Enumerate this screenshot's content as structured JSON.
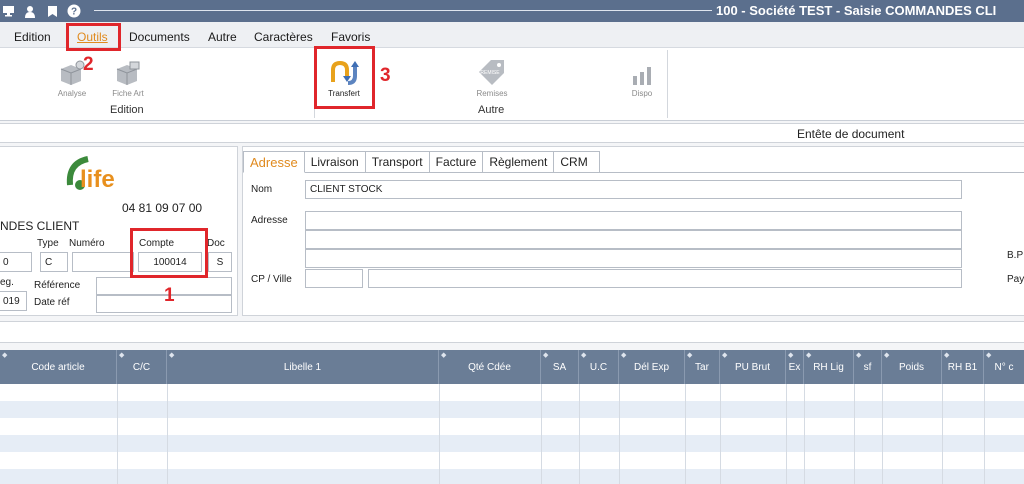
{
  "window": {
    "title": "100 - Société TEST - Saisie COMMANDES CLI"
  },
  "menu": {
    "items": [
      "Edition",
      "Outils",
      "Documents",
      "Autre",
      "Caractères",
      "Favoris"
    ]
  },
  "ribbon": {
    "buttons": {
      "analyse": "Analyse",
      "fiche_art": "Fiche Art",
      "transfert": "Transfert",
      "remises": "Remises",
      "dispo": "Dispo"
    },
    "groups": {
      "edition": "Edition",
      "autre": "Autre"
    }
  },
  "annotations": [
    "1",
    "2",
    "3"
  ],
  "header_strip": {
    "title": "Entête de document"
  },
  "left_panel": {
    "logo_text": "life",
    "phone": "04 81 09 07 00",
    "doc_title": "NDES CLIENT",
    "labels": {
      "type": "Type",
      "numero": "Numéro",
      "compte": "Compte",
      "doc": "Doc",
      "reg": "eg.",
      "reference": "Référence",
      "date_ref": "Date réf"
    },
    "fields": {
      "first": "0",
      "type": "C",
      "numero": "",
      "compte": "100014",
      "doc": "S",
      "date_partial": "019",
      "reference": "",
      "date_ref": ""
    }
  },
  "tabs": [
    "Adresse",
    "Livraison",
    "Transport",
    "Facture",
    "Règlement",
    "CRM"
  ],
  "address": {
    "labels": {
      "nom": "Nom",
      "adresse": "Adresse",
      "cp_ville": "CP / Ville",
      "bp": "B.P",
      "pays": "Pay"
    },
    "nom_value": "CLIENT STOCK",
    "adresse_lines": [
      "",
      "",
      ""
    ],
    "cp": "",
    "ville": ""
  },
  "grid": {
    "columns": [
      "Code article",
      "C/C",
      "Libelle 1",
      "Qté Cdée",
      "SA",
      "U.C",
      "Dél Exp",
      "Tar",
      "PU Brut",
      "Ex",
      "RH Lig",
      "sf",
      "Poids",
      "RH B1",
      "N° c"
    ]
  },
  "colors": {
    "title_bar": "#5b6f8d",
    "accent": "#e08a1e",
    "annotation": "#e0262b",
    "grid_header": "#6a7d96",
    "grid_alt_row": "#e6edf6"
  }
}
